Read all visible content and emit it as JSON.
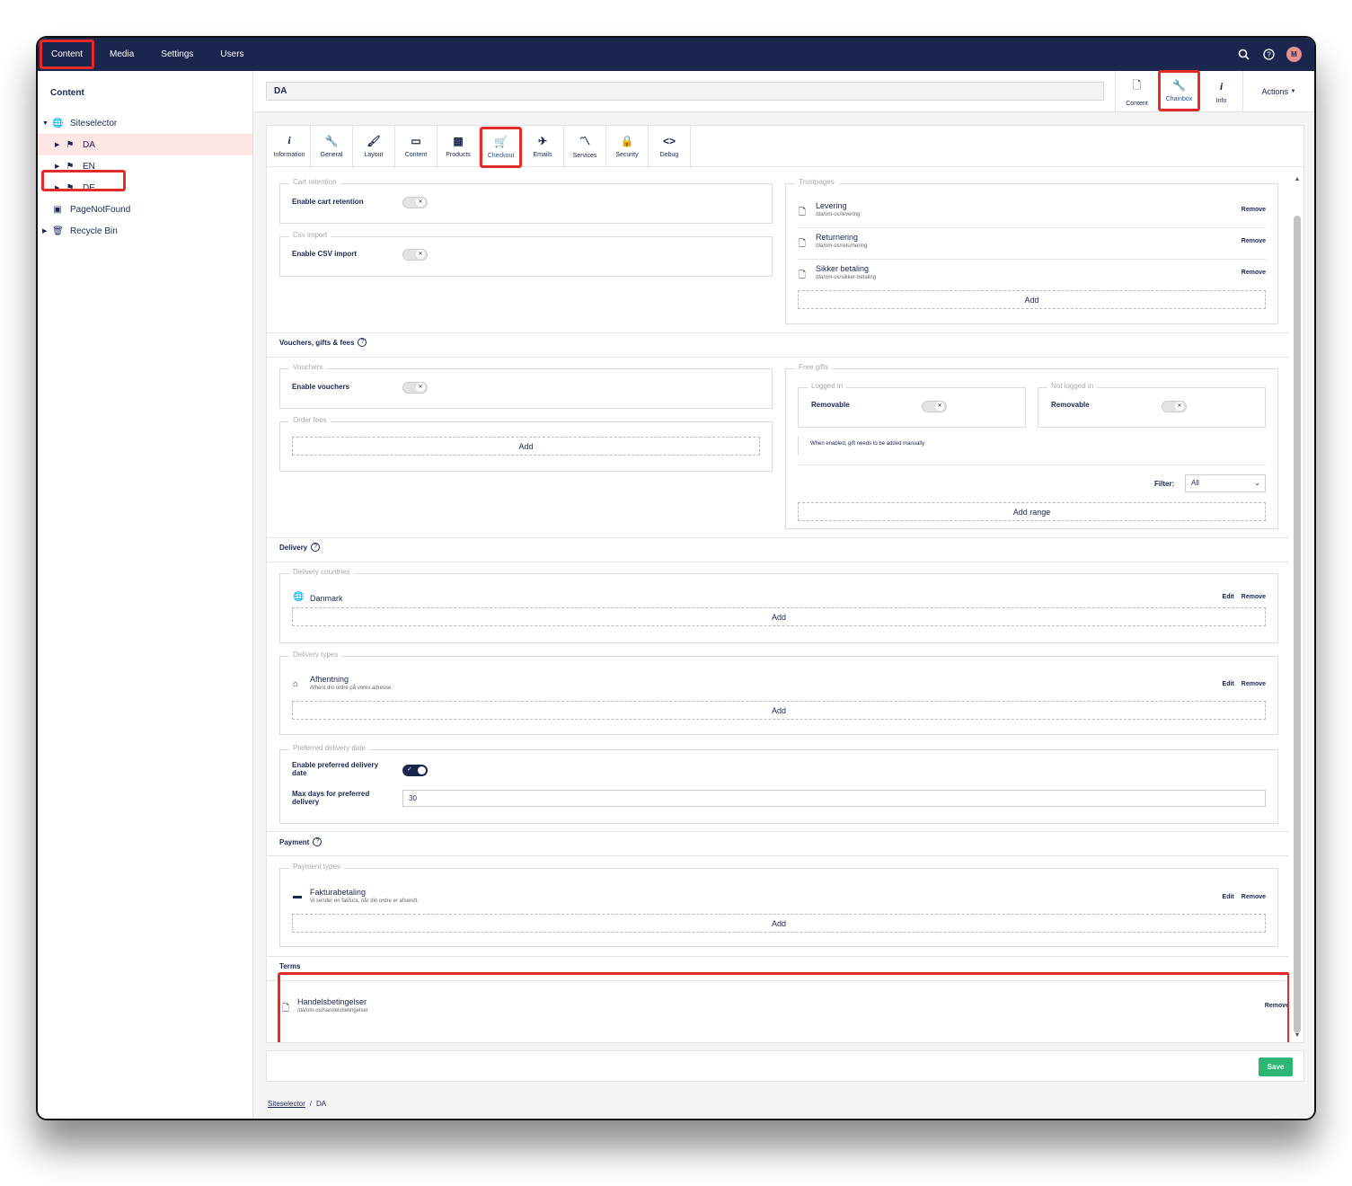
{
  "nav": {
    "items": [
      "Content",
      "Media",
      "Settings",
      "Users"
    ],
    "avatar": "M"
  },
  "sidebar": {
    "title": "Content",
    "tree": [
      {
        "label": "Siteselector",
        "icon": "globe-icon"
      },
      {
        "label": "DA",
        "icon": "flag-icon"
      },
      {
        "label": "EN",
        "icon": "flag-icon"
      },
      {
        "label": "DE",
        "icon": "flag-icon"
      },
      {
        "label": "PageNotFound",
        "icon": "page-not-found-icon"
      },
      {
        "label": "Recycle Bin",
        "icon": "trash-icon"
      }
    ]
  },
  "header": {
    "name": "DA",
    "apps": [
      "Content",
      "Chainbox",
      "Info"
    ],
    "actions": "Actions"
  },
  "tabs": [
    "Information",
    "General",
    "Layout",
    "Content",
    "Products",
    "Checkout",
    "Emails",
    "Services",
    "Security",
    "Debug"
  ],
  "cart": {
    "legend": "Cart retention",
    "label": "Enable cart retention"
  },
  "csv": {
    "legend": "Csv import",
    "label": "Enable CSV import"
  },
  "trust": {
    "legend": "Trustpages",
    "items": [
      {
        "title": "Levering",
        "path": "/da/om-os/levering"
      },
      {
        "title": "Returnering",
        "path": "/da/om-os/returnering"
      },
      {
        "title": "Sikker betaling",
        "path": "/da/om-os/sikker-betaling"
      }
    ],
    "remove": "Remove",
    "add": "Add"
  },
  "vouchers": {
    "title": "Vouchers, gifts & fees",
    "legend": "Vouchers",
    "label": "Enable vouchers",
    "fees_legend": "Order fees",
    "add": "Add"
  },
  "gifts": {
    "legend": "Free gifts",
    "logged_in": "Logged in",
    "not_logged_in": "Not logged in",
    "removable": "Removable",
    "note": "When enabled, gift needs to be added manually",
    "filter_label": "Filter:",
    "filter_value": "All",
    "add_range": "Add range"
  },
  "delivery": {
    "title": "Delivery",
    "countries_legend": "Delivery countries",
    "country": "Danmark",
    "types_legend": "Delivery types",
    "type_title": "Afhentning",
    "type_desc": "Afhent din ordre på vores adresse.",
    "date_legend": "Preferred delivery date",
    "date_label": "Enable preferred delivery date",
    "max_label": "Max days for preferred delivery",
    "max_value": "30",
    "edit": "Edit",
    "remove": "Remove",
    "add": "Add"
  },
  "payment": {
    "title": "Payment",
    "legend": "Payment types",
    "type_title": "Fakturabetaling",
    "type_desc": "Vi sender en faktura, når din ordre er afsendt.",
    "edit": "Edit",
    "remove": "Remove",
    "add": "Add"
  },
  "terms": {
    "title": "Terms",
    "item_title": "Handelsbetingelser",
    "item_path": "/da/om-os/handelsbetingelser",
    "remove": "Remove"
  },
  "footer": {
    "save": "Save"
  },
  "breadcrumb": [
    "Siteselector",
    "DA"
  ]
}
